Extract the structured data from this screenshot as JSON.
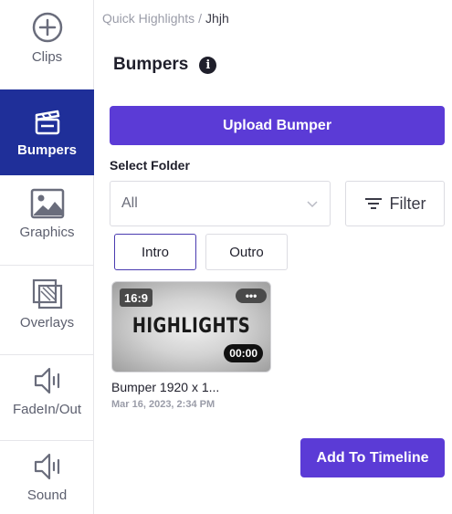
{
  "sidebar": {
    "items": [
      {
        "label": "Clips",
        "icon": "plus-circle-icon",
        "active": false
      },
      {
        "label": "Bumpers",
        "icon": "clapperboard-icon",
        "active": true
      },
      {
        "label": "Graphics",
        "icon": "image-icon",
        "active": false
      },
      {
        "label": "Overlays",
        "icon": "layers-icon",
        "active": false
      },
      {
        "label": "FadeIn/Out",
        "icon": "speaker-icon",
        "active": false
      },
      {
        "label": "Sound",
        "icon": "speaker-icon",
        "active": false
      }
    ]
  },
  "breadcrumb": {
    "root": "Quick Highlights",
    "separator": "/",
    "current": "Jhjh"
  },
  "header": {
    "title": "Bumpers",
    "info_icon": "i"
  },
  "upload_button": "Upload Bumper",
  "folder": {
    "label": "Select Folder",
    "selected": "All"
  },
  "filter_button": "Filter",
  "folder_tabs": [
    "Intro",
    "Outro"
  ],
  "bumpers": [
    {
      "thumbnail_text": "HIGHLIGHTS",
      "aspect": "16:9",
      "duration": "00:00",
      "more_icon": "•••",
      "name": "Bumper 1920 x 1...",
      "date": "Mar 16, 2023, 2:34 PM"
    }
  ],
  "add_button": "Add To Timeline",
  "colors": {
    "accent": "#5b3bd6",
    "sidebar_active": "#1f2f99",
    "muted": "#9a9ca8"
  }
}
